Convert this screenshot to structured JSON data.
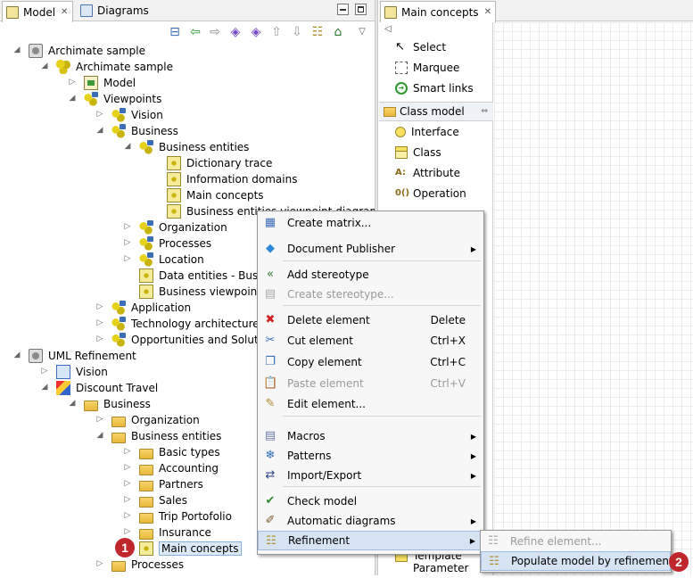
{
  "model_view": {
    "tabs": [
      {
        "label": "Model",
        "active": true
      },
      {
        "label": "Diagrams",
        "active": false
      }
    ],
    "tree": [
      {
        "label": "Archimate sample",
        "level": 0,
        "expanded": true,
        "icon": "project-icon"
      },
      {
        "label": "Archimate sample",
        "level": 1,
        "expanded": true,
        "icon": "package-icon"
      },
      {
        "label": "Model",
        "level": 2,
        "expanded": false,
        "icon": "model-icon"
      },
      {
        "label": "Viewpoints",
        "level": 2,
        "expanded": true,
        "icon": "viewpoint-icon"
      },
      {
        "label": "Vision",
        "level": 3,
        "expanded": false,
        "icon": "viewpoint-icon"
      },
      {
        "label": "Business",
        "level": 3,
        "expanded": true,
        "icon": "viewpoint-icon"
      },
      {
        "label": "Business entities",
        "level": 4,
        "expanded": true,
        "icon": "viewpoint-icon"
      },
      {
        "label": "Dictionary trace",
        "level": 5,
        "icon": "diagram-icon"
      },
      {
        "label": "Information domains",
        "level": 5,
        "icon": "diagram-icon"
      },
      {
        "label": "Main concepts",
        "level": 5,
        "icon": "diagram-icon"
      },
      {
        "label": "Business entities viewpoint diagrams",
        "level": 5,
        "icon": "diagram-icon"
      },
      {
        "label": "Organization",
        "level": 4,
        "expanded": false,
        "icon": "viewpoint-icon"
      },
      {
        "label": "Processes",
        "level": 4,
        "expanded": false,
        "icon": "viewpoint-icon"
      },
      {
        "label": "Location",
        "level": 4,
        "expanded": false,
        "icon": "viewpoint-icon"
      },
      {
        "label": "Data entities - Business viewpoint",
        "level": 4,
        "icon": "diagram-icon"
      },
      {
        "label": "Business viewpoint diagrams",
        "level": 4,
        "icon": "diagram-icon"
      },
      {
        "label": "Application",
        "level": 3,
        "expanded": false,
        "icon": "viewpoint-icon"
      },
      {
        "label": "Technology architecture",
        "level": 3,
        "expanded": false,
        "icon": "viewpoint-icon"
      },
      {
        "label": "Opportunities and Solutions",
        "level": 3,
        "expanded": false,
        "icon": "viewpoint-icon"
      },
      {
        "label": "UML Refinement",
        "level": 0,
        "expanded": true,
        "icon": "project-icon"
      },
      {
        "label": "Vision",
        "level": 1,
        "expanded": false,
        "icon": "blue-model-icon"
      },
      {
        "label": "Discount Travel",
        "level": 1,
        "expanded": true,
        "icon": "discount-travel-icon"
      },
      {
        "label": "Business",
        "level": 2,
        "expanded": true,
        "icon": "folder-icon"
      },
      {
        "label": "Organization",
        "level": 3,
        "expanded": false,
        "icon": "folder-icon"
      },
      {
        "label": "Business entities",
        "level": 3,
        "expanded": true,
        "icon": "folder-icon"
      },
      {
        "label": "Basic types",
        "level": 4,
        "expanded": false,
        "icon": "folder-icon"
      },
      {
        "label": "Accounting",
        "level": 4,
        "expanded": false,
        "icon": "folder-icon"
      },
      {
        "label": "Partners",
        "level": 4,
        "expanded": false,
        "icon": "folder-icon"
      },
      {
        "label": "Sales",
        "level": 4,
        "expanded": false,
        "icon": "folder-icon"
      },
      {
        "label": "Trip Portofolio",
        "level": 4,
        "expanded": false,
        "icon": "folder-icon"
      },
      {
        "label": "Insurance",
        "level": 4,
        "expanded": false,
        "icon": "folder-icon"
      },
      {
        "label": "Main concepts",
        "level": 4,
        "icon": "diagram-icon",
        "selected": true
      },
      {
        "label": "Processes",
        "level": 3,
        "expanded": false,
        "icon": "folder-icon"
      }
    ]
  },
  "diagram_editor": {
    "tab_label": "Main concepts",
    "palette": {
      "tools": [
        "Select",
        "Marquee",
        "Smart links"
      ],
      "group_label": "Class model",
      "items": [
        "Interface",
        "Class",
        "Attribute",
        "Operation"
      ],
      "bottom_item": "Template Parameter"
    }
  },
  "context_menu": {
    "items": [
      {
        "label": "Create matrix...",
        "icon": "matrix-icon"
      },
      {
        "label": "Document Publisher",
        "icon": "document-publisher-icon",
        "submenu": true
      },
      {
        "label": "Add stereotype",
        "icon": "add-stereotype-icon"
      },
      {
        "label": "Create stereotype...",
        "icon": "create-stereotype-icon",
        "disabled": true
      },
      {
        "label": "Delete element",
        "icon": "delete-icon",
        "shortcut": "Delete"
      },
      {
        "label": "Cut element",
        "icon": "cut-icon",
        "shortcut": "Ctrl+X"
      },
      {
        "label": "Copy element",
        "icon": "copy-icon",
        "shortcut": "Ctrl+C"
      },
      {
        "label": "Paste element",
        "icon": "paste-icon",
        "shortcut": "Ctrl+V",
        "disabled": true
      },
      {
        "label": "Edit element...",
        "icon": "edit-icon"
      },
      {
        "label": "Macros",
        "icon": "macros-icon",
        "submenu": true
      },
      {
        "label": "Patterns",
        "icon": "patterns-icon",
        "submenu": true
      },
      {
        "label": "Import/Export",
        "icon": "import-export-icon",
        "submenu": true
      },
      {
        "label": "Check model",
        "icon": "check-model-icon"
      },
      {
        "label": "Automatic diagrams",
        "icon": "automatic-diagrams-icon",
        "submenu": true
      },
      {
        "label": "Refinement",
        "icon": "refinement-icon",
        "submenu": true,
        "highlighted": true
      }
    ]
  },
  "submenu": {
    "items": [
      {
        "label": "Refine element...",
        "disabled": true
      },
      {
        "label": "Populate model by refinement...",
        "highlighted": true
      }
    ]
  },
  "callouts": [
    "1",
    "2"
  ]
}
